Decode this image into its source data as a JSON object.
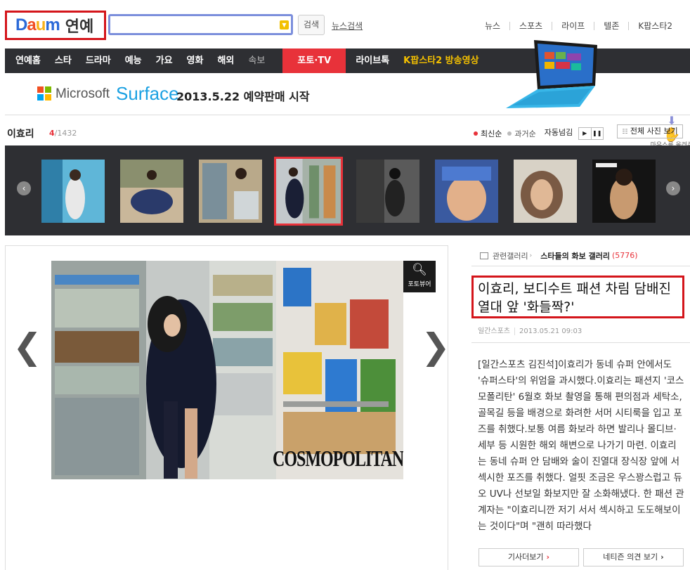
{
  "header": {
    "logo_text": "Daum",
    "section_title": "연예",
    "search_placeholder": "",
    "search_button": "검색",
    "news_search_link": "뉴스검색",
    "top_links": [
      "뉴스",
      "스포츠",
      "라이프",
      "텔존",
      "K팝스타2"
    ]
  },
  "gnb": {
    "items": [
      "연예홈",
      "스타",
      "드라마",
      "예능",
      "가요",
      "영화",
      "해외",
      "속보"
    ],
    "active_item": "포토·TV",
    "extra_items": [
      "라이브톡",
      "K팝스타2 방송영상"
    ]
  },
  "ad": {
    "brand": "Microsoft",
    "product": "Surface",
    "text": "2013.5.22 예약판매 시작",
    "mouse_hint": "마우스를 올려주세요!"
  },
  "gallery": {
    "name": "이효리",
    "current": "4",
    "total": "/1432",
    "sort_latest": "최신순",
    "sort_oldest": "과거순",
    "autoplay_label": "자동넘김",
    "all_photos_label": "전체 사진 보기",
    "selected_index": 3
  },
  "photo": {
    "watermark": "COSMOPOLITAN",
    "viewer_label": "포토뷰어"
  },
  "article": {
    "related_label": "관련갤러리",
    "related_name": "스타들의 화보 갤러리",
    "related_count": "(5776)",
    "headline": "이효리, 보디수트 패션 차림 담배진열대 앞 '화들짝?'",
    "source": "일간스포츠",
    "date": "2013.05.21 09:03",
    "body": "[일간스포츠 김진석]이효리가 동네 슈퍼 안에서도 '슈퍼스타'의 위엄을 과시했다.이효리는 패션지 '코스모폴리탄' 6월호 화보 촬영을 통해 편의점과 세탁소, 골목길 등을 배경으로 화려한 서머 시티룩을 입고 포즈를 취했다.보통 여름 화보라 하면 발리나 몰디브·세부 등 시원한 해외 해변으로 나가기 마련. 이효리는 동네 슈퍼 안 담배와 술이 진열대 장식장 앞에 서 섹시한 포즈를 취했다. 얼핏 조금은 우스꽝스럽고 듀오 UV나 선보일 화보지만 잘 소화해냈다. 한 패션 관계자는 \"이효리니깐 저기 서서 섹시하고 도도해보이는 것이다\"며 \"괜히 따라했다",
    "more_button": "기사더보기",
    "comments_button": "네티즌 의견 보기"
  }
}
